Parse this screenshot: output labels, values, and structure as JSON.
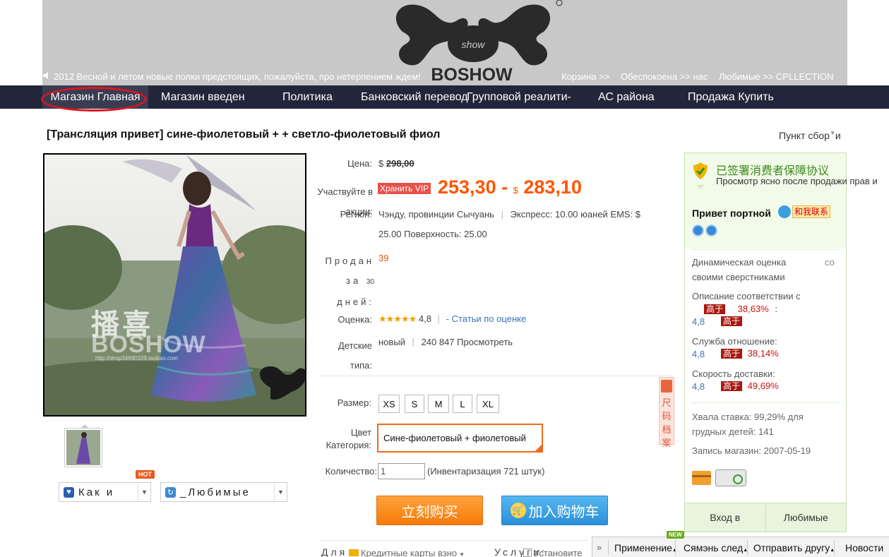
{
  "header": {
    "logo_text": "BOSHOW",
    "announcement": "2012 Весной и летом новые полки предстоящих, пожалуйста, про нетерпением ждем!",
    "top_links": [
      "Корзина >>",
      "Обеспокоена >> нас",
      "Любимые >> CPLLECTION"
    ]
  },
  "nav": {
    "items": [
      "Магазин Главная",
      "Магазин введен",
      "Политика",
      "Банковский перевод",
      "Групповой реалити-",
      "АС района",
      "Продажа Купить"
    ]
  },
  "product": {
    "title": "[Трансляция привет] сине-фиолетовый + + светло-фиолетовый фиол",
    "collect_point": "Пункт сбор",
    "collect_suffix": "и",
    "image_watermark_cn": "播喜",
    "image_watermark": "BOSHOW",
    "image_url_text": "http://shop34690109.taobao.com",
    "price_label": "Цена:",
    "currency": "$",
    "old_price": "298,00",
    "promo_label": "Участвуйте в акции:",
    "vip_tag": "Хранить VIP",
    "price_low": "253,30",
    "price_dash": "-",
    "price_high": "283,10",
    "region_label": "Регион:",
    "region_value": "Чэнду, провинции Сычуань",
    "express_value": "Экспресс: 10.00 юаней EMS: $",
    "express_value2": "25.00 Поверхность: 25.00",
    "sold_label": "Продан за",
    "sold_days": "30",
    "sold_label2": "дней:",
    "sold_value": "39",
    "rating_label": "Оценка:",
    "rating_stars": "★★★★★",
    "rating_value": "4,8",
    "rating_link": "- Статьи по оценке",
    "children_label": "Детские типа:",
    "children_value": "новый",
    "views_value": "240 847 Просмотреть",
    "size_label": "Размер:",
    "sizes": [
      "XS",
      "S",
      "M",
      "L",
      "XL"
    ],
    "color_label": "Цвет Категория:",
    "color_value": "Сине-фиолетовый + фиолетовый",
    "size_archive": "尺码档案",
    "qty_label": "Количество:",
    "qty_value": "1",
    "inventory": "(Инвентаризация 721 штук)",
    "buy_now": "立刻购买",
    "add_cart": "加入购物车",
    "bottom_label1": "Для",
    "bottom_credit": "Кредитные карты взно",
    "bottom_label2": "Услуги:",
    "bottom_install": "Установите",
    "share_label": "Как и",
    "fav_label": "_Любимые",
    "hot_badge": "HOT"
  },
  "shop": {
    "guarantee": "已签署消费者保障协议",
    "guarantee_sub": "Просмотр ясно после продажи прав и",
    "shop_name": "Привет портной",
    "contact": "和我联系",
    "dynamic_label": "Динамическая оценка",
    "dynamic_suffix": "со",
    "dynamic_label2": "своими сверстниками",
    "desc_label": "Описание соответствии с",
    "desc_pct": "38,63%",
    "desc_colon": ":",
    "desc_score": "4,8",
    "higher": "高于",
    "service_label": "Служба отношение:",
    "service_score": "4,8",
    "service_pct": "38,14%",
    "delivery_label": "Скорость доставки:",
    "delivery_score": "4,8",
    "delivery_pct": "49,69%",
    "praise_line1": "Хвала ставка: 99,29% для",
    "praise_line2": "грудных детей: 141",
    "record": "Запись магазин: 2007-05-19",
    "enter": "Вход в",
    "favorites": "Любимые"
  },
  "bottom_bar": {
    "new_badge": "NEW",
    "items": [
      "Применение",
      "Сямэнь след",
      "Отправить другу",
      "Новости"
    ]
  },
  "colors": {
    "nav_bg": "#23263a",
    "price_orange": "#ff5500",
    "shop_border": "#c9e3b0",
    "buy_orange": "#f57a08",
    "cart_blue": "#2a8fd8"
  }
}
